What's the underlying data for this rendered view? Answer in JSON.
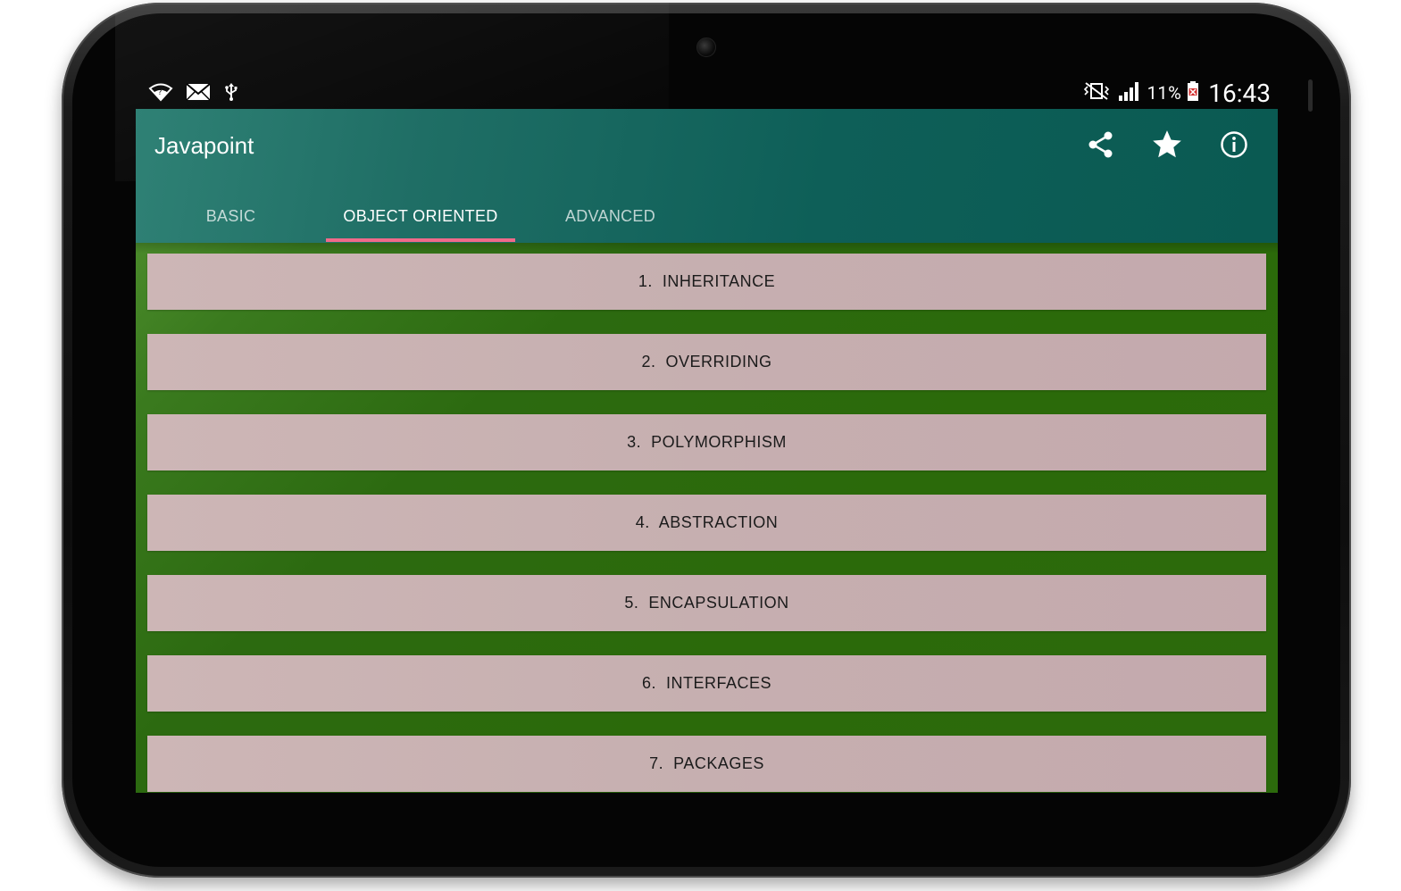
{
  "status_bar": {
    "left_icons": [
      "wifi-icon",
      "mail-icon",
      "usb-icon"
    ],
    "right_icons": [
      "vibrate-icon",
      "signal-icon",
      "battery-icon"
    ],
    "battery_percent": "11%",
    "time": "16:43"
  },
  "app": {
    "title": "Javapoint",
    "actions": [
      "share-icon",
      "star-icon",
      "info-icon"
    ]
  },
  "tabs": [
    {
      "label": "BASIC",
      "active": false
    },
    {
      "label": "OBJECT ORIENTED",
      "active": true
    },
    {
      "label": "ADVANCED",
      "active": false
    }
  ],
  "list": {
    "items": [
      {
        "label": "1.  INHERITANCE"
      },
      {
        "label": "2.  OVERRIDING"
      },
      {
        "label": "3.  POLYMORPHISM"
      },
      {
        "label": "4.  ABSTRACTION"
      },
      {
        "label": "5.  ENCAPSULATION"
      },
      {
        "label": "6.  INTERFACES"
      },
      {
        "label": "7.  PACKAGES"
      }
    ]
  },
  "colors": {
    "appbar": "#1f6e65",
    "tab_indicator": "#f06a8a",
    "content_bg": "#2c6a0c",
    "item_bg": "#c6afb0"
  }
}
